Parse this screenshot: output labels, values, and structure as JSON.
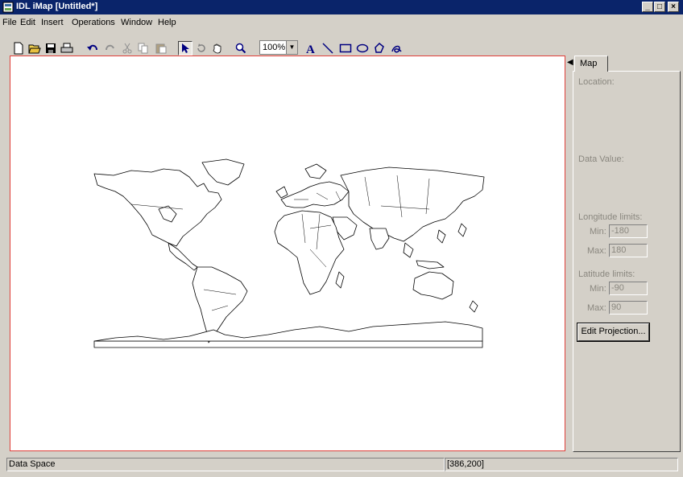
{
  "window": {
    "title": "IDL iMap [Untitled*]",
    "minimize": "_",
    "maximize": "□",
    "close": "×"
  },
  "menu": [
    "File",
    "Edit",
    "Insert",
    "Operations",
    "Window",
    "Help"
  ],
  "toolbar": {
    "zoom_value": "100%"
  },
  "panel": {
    "tab_label": "Map",
    "location_label": "Location:",
    "data_value_label": "Data Value:",
    "longitude_label": "Longitude limits:",
    "lon_min_label": "Min:",
    "lon_min": "-180",
    "lon_max_label": "Max:",
    "lon_max": "180",
    "latitude_label": "Latitude limits:",
    "lat_min_label": "Min:",
    "lat_min": "-90",
    "lat_max_label": "Max:",
    "lat_max": "90",
    "edit_projection": "Edit Projection..."
  },
  "status": {
    "left": "Data Space",
    "coords": "[386,200]"
  }
}
